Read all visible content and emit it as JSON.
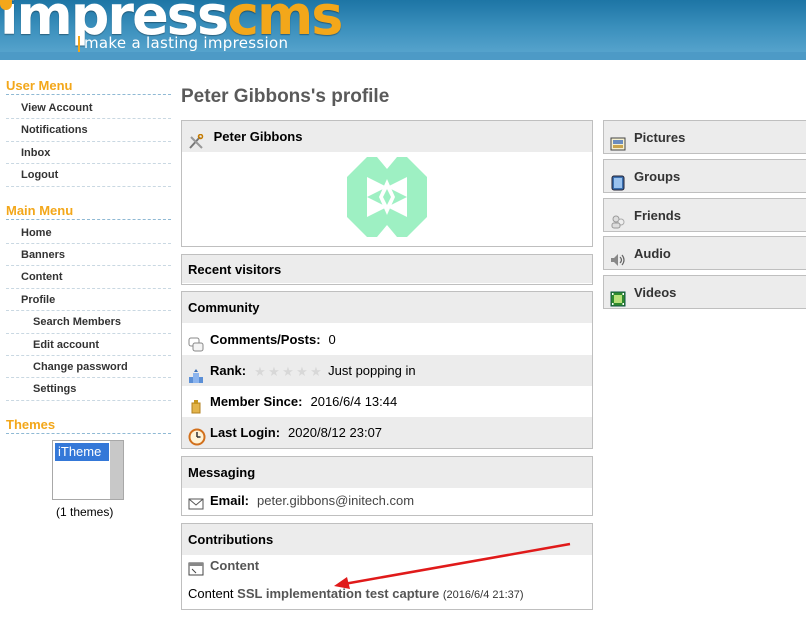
{
  "header": {
    "logo_part1": "impress",
    "logo_part2": "cms",
    "tagline": "make a lasting impression",
    "colors": {
      "header_blue": "#2e86b8",
      "logo_orange": "#f3a71a"
    }
  },
  "sidebar": {
    "user_menu": {
      "title": "User Menu",
      "items": [
        "View Account",
        "Notifications",
        "Inbox",
        "Logout"
      ]
    },
    "main_menu": {
      "title": "Main Menu",
      "items": [
        "Home",
        "Banners",
        "Content",
        "Profile"
      ],
      "sub_items": [
        "Search Members",
        "Edit account",
        "Change password",
        "Settings"
      ]
    },
    "themes": {
      "title": "Themes",
      "selected": "iTheme",
      "count_text": "(1 themes)"
    }
  },
  "page_title": "Peter Gibbons's profile",
  "profile": {
    "name": "Peter Gibbons",
    "icon": "tools-icon",
    "avatar_colors": {
      "fill": "#9ef0c3",
      "background": "#ffffff"
    }
  },
  "recent_visitors": {
    "title": "Recent visitors"
  },
  "community": {
    "title": "Community",
    "comments_label": "Comments/Posts:",
    "comments_value": "0",
    "rank_label": "Rank:",
    "rank_stars_filled": 0,
    "rank_stars_total": 5,
    "rank_value": "Just popping in",
    "member_since_label": "Member Since:",
    "member_since_value": "2016/6/4 13:44",
    "last_login_label": "Last Login:",
    "last_login_value": "2020/8/12 23:07"
  },
  "messaging": {
    "title": "Messaging",
    "email_label": "Email:",
    "email_value": "peter.gibbons@initech.com"
  },
  "contributions": {
    "title": "Contributions",
    "section_label": "Content",
    "item_prefix": "Content",
    "item_title": "SSL implementation test capture",
    "item_date": "(2016/6/4 21:37)"
  },
  "right_menu": [
    "Pictures",
    "Groups",
    "Friends",
    "Audio",
    "Videos"
  ],
  "annotation": {
    "arrow_color": "#e01a1a"
  }
}
